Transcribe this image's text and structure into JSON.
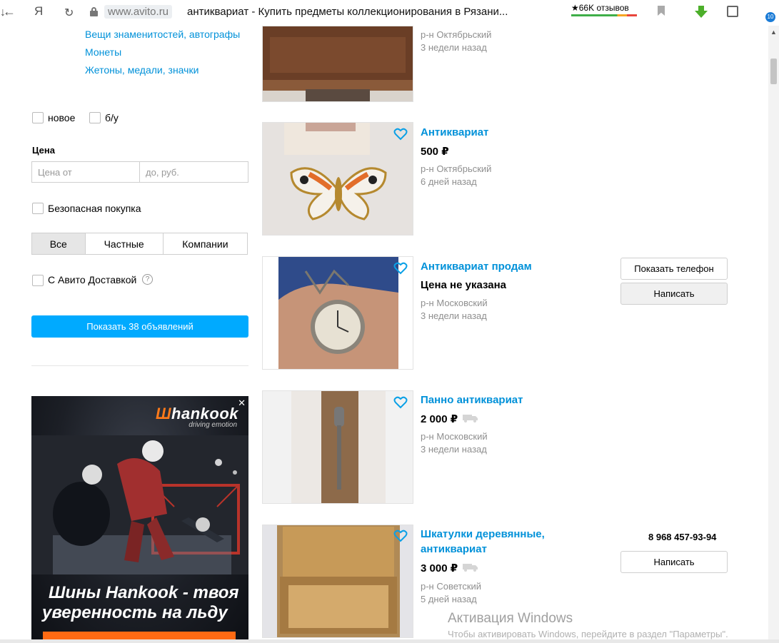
{
  "browser": {
    "back": "←",
    "yandex": "Я",
    "reload": "↻",
    "host": "www.avito.ru",
    "title": "антиквариат - Купить предметы коллекционирования в Рязани...",
    "reviews": "★66K отзывов",
    "download_badge": "10"
  },
  "sidebar": {
    "links": [
      "Вещи знаменитостей, автографы",
      "Монеты",
      "Жетоны, медали, значки"
    ],
    "condition": {
      "new": "новое",
      "used": "б/у"
    },
    "price_label": "Цена",
    "price_from_placeholder": "Цена от",
    "price_to_placeholder": "до, руб.",
    "safe_purchase": "Безопасная покупка",
    "seller_tabs": [
      "Все",
      "Частные",
      "Компании"
    ],
    "delivery": "С Авито Доставкой",
    "help": "?",
    "show_button": "Показать 38 объявлений"
  },
  "ad": {
    "close": "✕",
    "brand": "hankook",
    "tagline": "driving emotion",
    "headline_1": "Шины Hankook - твоя",
    "headline_2": "уверенность на льду"
  },
  "listings": [
    {
      "title": "",
      "price": "",
      "district": "р-н Октябрьский",
      "date": "3 недели назад"
    },
    {
      "title": "Антиквариат",
      "price": "500 ₽",
      "district": "р-н Октябрьский",
      "date": "6 дней назад"
    },
    {
      "title": "Антиквариат продам",
      "price": "Цена не указана",
      "district": "р-н Московский",
      "date": "3 недели назад",
      "buttons": {
        "phone": "Показать телефон",
        "write": "Написать"
      }
    },
    {
      "title": "Панно антиквариат",
      "price": "2 000 ₽",
      "district": "р-н Московский",
      "date": "3 недели назад"
    },
    {
      "title_1": "Шкатулки деревянные,",
      "title_2": "антиквариат",
      "price": "3 000 ₽",
      "district": "р-н Советский",
      "date": "5 дней назад",
      "phone": "8 968 457-93-94",
      "buttons": {
        "write": "Написать"
      }
    }
  ],
  "watermark": {
    "line1": "Активация Windows",
    "line2": "Чтобы активировать Windows, перейдите в раздел \"Параметры\"."
  },
  "colors": {
    "link": "#0091d9",
    "button": "#00aaff",
    "meta": "#8f8f8f",
    "ad_accent": "#ff6a13"
  }
}
